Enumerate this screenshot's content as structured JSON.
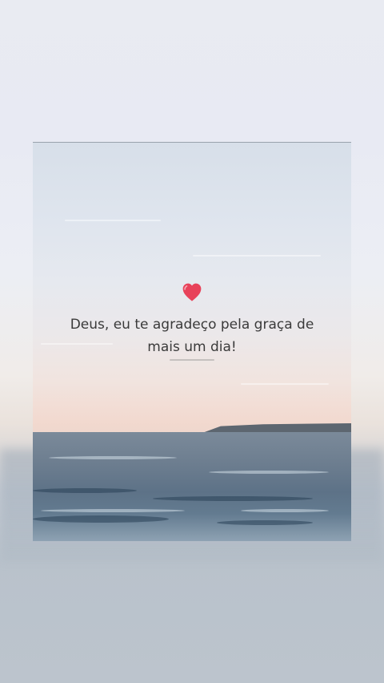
{
  "post": {
    "icon": "red-heart-icon",
    "quote_line1": "Deus, eu te agradeço pela graça de",
    "quote_line2": "mais um dia!"
  },
  "colors": {
    "heart": "#e8425a",
    "text": "#3a3a3a",
    "sea": "#5d7287",
    "sky": "#dfe5ee"
  }
}
